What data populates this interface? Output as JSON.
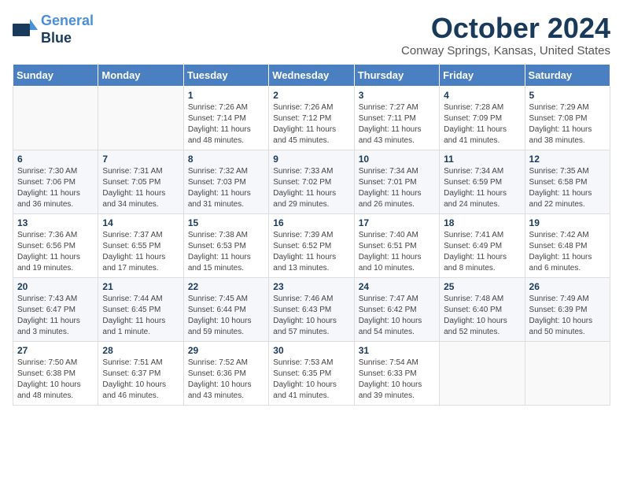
{
  "header": {
    "logo_line1": "General",
    "logo_line2": "Blue",
    "month_title": "October 2024",
    "location": "Conway Springs, Kansas, United States"
  },
  "weekdays": [
    "Sunday",
    "Monday",
    "Tuesday",
    "Wednesday",
    "Thursday",
    "Friday",
    "Saturday"
  ],
  "weeks": [
    [
      {
        "day": "",
        "info": ""
      },
      {
        "day": "",
        "info": ""
      },
      {
        "day": "1",
        "info": "Sunrise: 7:26 AM\nSunset: 7:14 PM\nDaylight: 11 hours\nand 48 minutes."
      },
      {
        "day": "2",
        "info": "Sunrise: 7:26 AM\nSunset: 7:12 PM\nDaylight: 11 hours\nand 45 minutes."
      },
      {
        "day": "3",
        "info": "Sunrise: 7:27 AM\nSunset: 7:11 PM\nDaylight: 11 hours\nand 43 minutes."
      },
      {
        "day": "4",
        "info": "Sunrise: 7:28 AM\nSunset: 7:09 PM\nDaylight: 11 hours\nand 41 minutes."
      },
      {
        "day": "5",
        "info": "Sunrise: 7:29 AM\nSunset: 7:08 PM\nDaylight: 11 hours\nand 38 minutes."
      }
    ],
    [
      {
        "day": "6",
        "info": "Sunrise: 7:30 AM\nSunset: 7:06 PM\nDaylight: 11 hours\nand 36 minutes."
      },
      {
        "day": "7",
        "info": "Sunrise: 7:31 AM\nSunset: 7:05 PM\nDaylight: 11 hours\nand 34 minutes."
      },
      {
        "day": "8",
        "info": "Sunrise: 7:32 AM\nSunset: 7:03 PM\nDaylight: 11 hours\nand 31 minutes."
      },
      {
        "day": "9",
        "info": "Sunrise: 7:33 AM\nSunset: 7:02 PM\nDaylight: 11 hours\nand 29 minutes."
      },
      {
        "day": "10",
        "info": "Sunrise: 7:34 AM\nSunset: 7:01 PM\nDaylight: 11 hours\nand 26 minutes."
      },
      {
        "day": "11",
        "info": "Sunrise: 7:34 AM\nSunset: 6:59 PM\nDaylight: 11 hours\nand 24 minutes."
      },
      {
        "day": "12",
        "info": "Sunrise: 7:35 AM\nSunset: 6:58 PM\nDaylight: 11 hours\nand 22 minutes."
      }
    ],
    [
      {
        "day": "13",
        "info": "Sunrise: 7:36 AM\nSunset: 6:56 PM\nDaylight: 11 hours\nand 19 minutes."
      },
      {
        "day": "14",
        "info": "Sunrise: 7:37 AM\nSunset: 6:55 PM\nDaylight: 11 hours\nand 17 minutes."
      },
      {
        "day": "15",
        "info": "Sunrise: 7:38 AM\nSunset: 6:53 PM\nDaylight: 11 hours\nand 15 minutes."
      },
      {
        "day": "16",
        "info": "Sunrise: 7:39 AM\nSunset: 6:52 PM\nDaylight: 11 hours\nand 13 minutes."
      },
      {
        "day": "17",
        "info": "Sunrise: 7:40 AM\nSunset: 6:51 PM\nDaylight: 11 hours\nand 10 minutes."
      },
      {
        "day": "18",
        "info": "Sunrise: 7:41 AM\nSunset: 6:49 PM\nDaylight: 11 hours\nand 8 minutes."
      },
      {
        "day": "19",
        "info": "Sunrise: 7:42 AM\nSunset: 6:48 PM\nDaylight: 11 hours\nand 6 minutes."
      }
    ],
    [
      {
        "day": "20",
        "info": "Sunrise: 7:43 AM\nSunset: 6:47 PM\nDaylight: 11 hours\nand 3 minutes."
      },
      {
        "day": "21",
        "info": "Sunrise: 7:44 AM\nSunset: 6:45 PM\nDaylight: 11 hours\nand 1 minute."
      },
      {
        "day": "22",
        "info": "Sunrise: 7:45 AM\nSunset: 6:44 PM\nDaylight: 10 hours\nand 59 minutes."
      },
      {
        "day": "23",
        "info": "Sunrise: 7:46 AM\nSunset: 6:43 PM\nDaylight: 10 hours\nand 57 minutes."
      },
      {
        "day": "24",
        "info": "Sunrise: 7:47 AM\nSunset: 6:42 PM\nDaylight: 10 hours\nand 54 minutes."
      },
      {
        "day": "25",
        "info": "Sunrise: 7:48 AM\nSunset: 6:40 PM\nDaylight: 10 hours\nand 52 minutes."
      },
      {
        "day": "26",
        "info": "Sunrise: 7:49 AM\nSunset: 6:39 PM\nDaylight: 10 hours\nand 50 minutes."
      }
    ],
    [
      {
        "day": "27",
        "info": "Sunrise: 7:50 AM\nSunset: 6:38 PM\nDaylight: 10 hours\nand 48 minutes."
      },
      {
        "day": "28",
        "info": "Sunrise: 7:51 AM\nSunset: 6:37 PM\nDaylight: 10 hours\nand 46 minutes."
      },
      {
        "day": "29",
        "info": "Sunrise: 7:52 AM\nSunset: 6:36 PM\nDaylight: 10 hours\nand 43 minutes."
      },
      {
        "day": "30",
        "info": "Sunrise: 7:53 AM\nSunset: 6:35 PM\nDaylight: 10 hours\nand 41 minutes."
      },
      {
        "day": "31",
        "info": "Sunrise: 7:54 AM\nSunset: 6:33 PM\nDaylight: 10 hours\nand 39 minutes."
      },
      {
        "day": "",
        "info": ""
      },
      {
        "day": "",
        "info": ""
      }
    ]
  ]
}
